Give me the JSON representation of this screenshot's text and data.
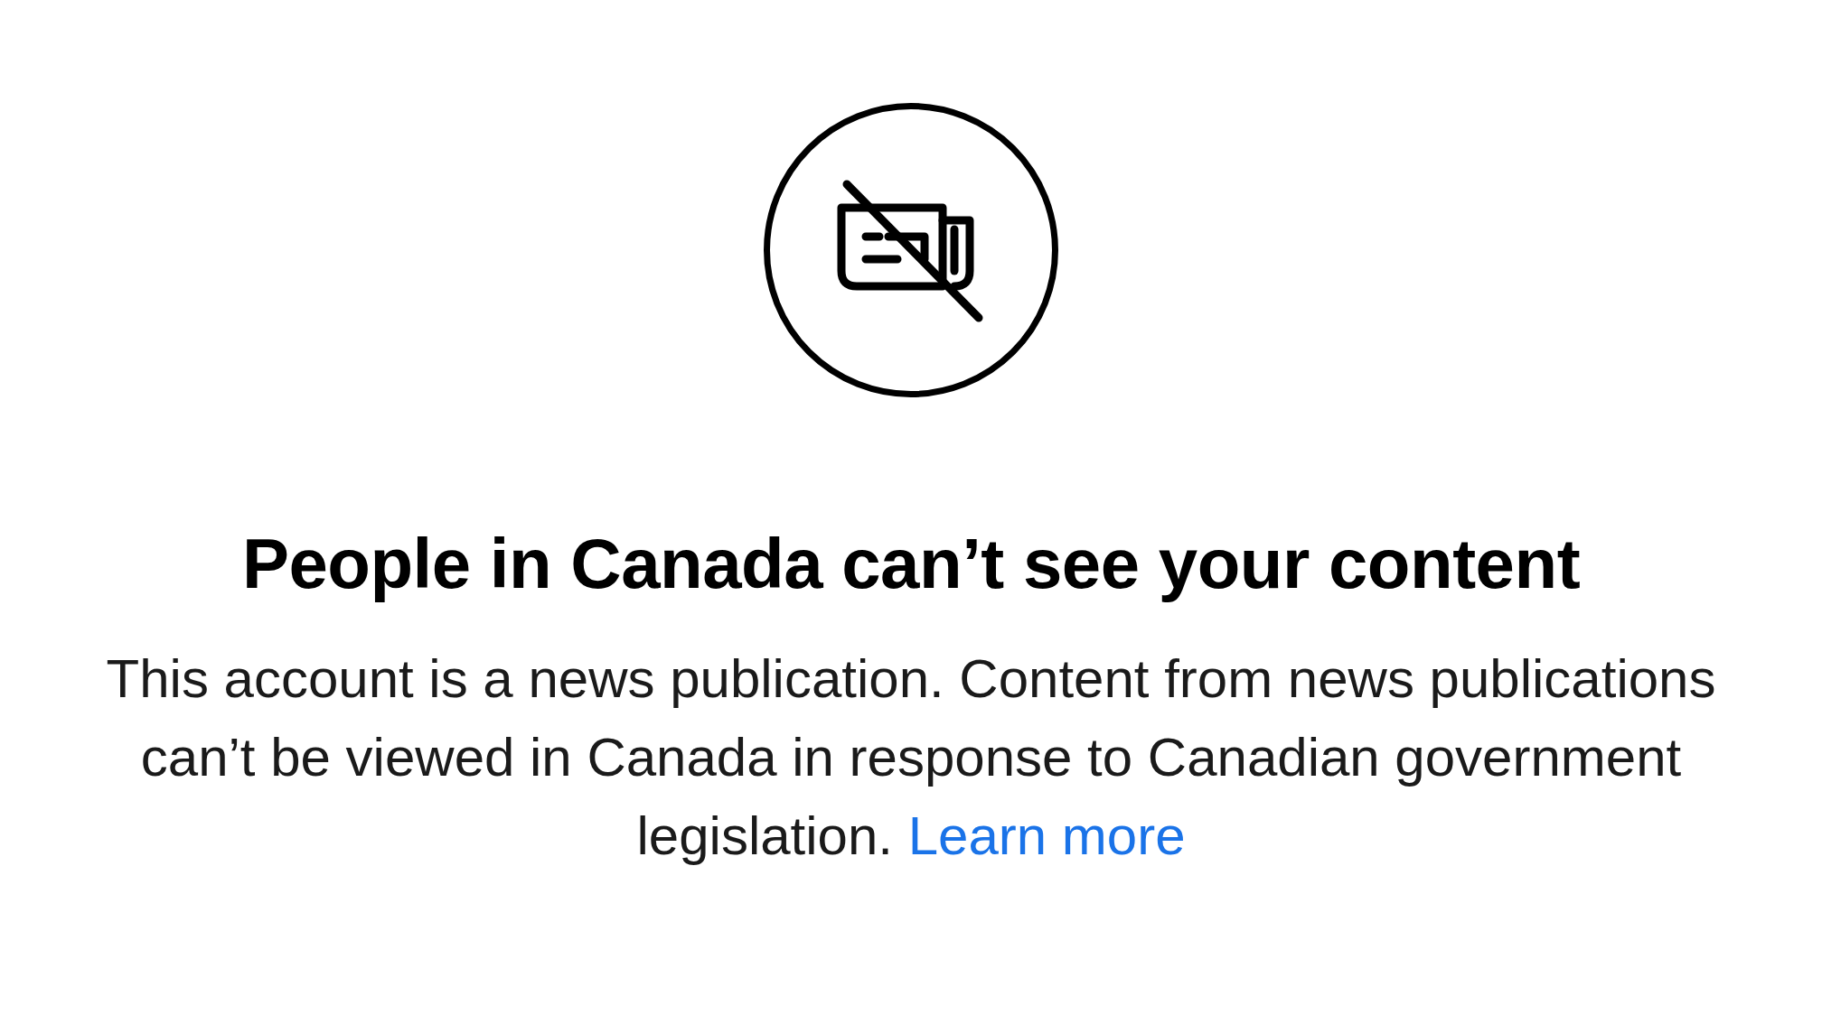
{
  "title": "People in Canada can’t see your content",
  "body": "This account is a news publication. Content from news publications can’t be viewed in Canada in response to Canadian government legislation.",
  "link": "Learn more"
}
